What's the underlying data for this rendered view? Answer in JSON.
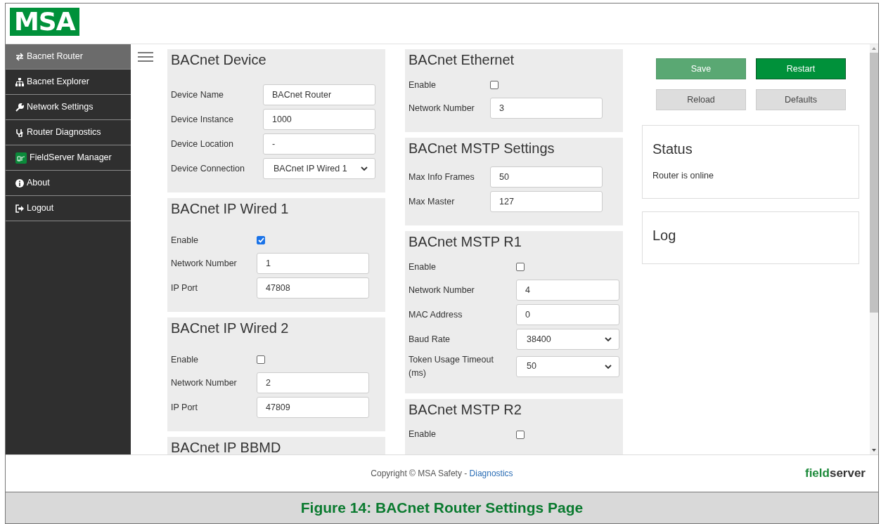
{
  "logo": "MSA",
  "sidebar": {
    "items": [
      {
        "label": "Bacnet Router",
        "selected": true
      },
      {
        "label": "Bacnet Explorer",
        "selected": false
      },
      {
        "label": "Network Settings",
        "selected": false
      },
      {
        "label": "Router Diagnostics",
        "selected": false
      },
      {
        "label": "FieldServer Manager",
        "selected": false
      },
      {
        "label": "About",
        "selected": false
      },
      {
        "label": "Logout",
        "selected": false
      }
    ]
  },
  "columns": [
    [
      {
        "title": "BACnet Device",
        "fields": [
          {
            "label": "Device Name",
            "kind": "text",
            "value": "BACnet Router"
          },
          {
            "label": "Device Instance",
            "kind": "text",
            "value": "1000"
          },
          {
            "label": "Device Location",
            "kind": "text",
            "value": "-"
          },
          {
            "label": "Device Connection",
            "kind": "select",
            "value": "BACnet IP Wired 1"
          }
        ]
      },
      {
        "title": "BACnet IP Wired 1",
        "fields": [
          {
            "label": "Enable",
            "kind": "checkbox",
            "checked": true
          },
          {
            "label": "Network Number",
            "kind": "text",
            "value": "1"
          },
          {
            "label": "IP Port",
            "kind": "text",
            "value": "47808"
          }
        ]
      },
      {
        "title": "BACnet IP Wired 2",
        "fields": [
          {
            "label": "Enable",
            "kind": "checkbox",
            "checked": false
          },
          {
            "label": "Network Number",
            "kind": "text",
            "value": "2"
          },
          {
            "label": "IP Port",
            "kind": "text",
            "value": "47809"
          }
        ]
      },
      {
        "title": "BACnet IP BBMD"
      }
    ],
    [
      {
        "title": "BACnet Ethernet",
        "fields": [
          {
            "label": "Enable",
            "kind": "checkbox",
            "checked": false
          },
          {
            "label": "Network Number",
            "kind": "text",
            "value": "3"
          }
        ]
      },
      {
        "title": "BACnet MSTP Settings",
        "fields": [
          {
            "label": "Max Info Frames",
            "kind": "text",
            "value": "50"
          },
          {
            "label": "Max Master",
            "kind": "text",
            "value": "127"
          }
        ]
      },
      {
        "title": "BACnet MSTP R1",
        "fields": [
          {
            "label": "Enable",
            "kind": "checkbox",
            "checked": false
          },
          {
            "label": "Network Number",
            "kind": "text",
            "value": "4"
          },
          {
            "label": "MAC Address",
            "kind": "text",
            "value": "0"
          },
          {
            "label": "Baud Rate",
            "kind": "select",
            "value": "38400"
          },
          {
            "label": "Token Usage Timeout (ms)",
            "kind": "select",
            "value": "50"
          }
        ]
      },
      {
        "title": "BACnet MSTP R2",
        "fields": [
          {
            "label": "Enable",
            "kind": "checkbox",
            "checked": false
          }
        ]
      }
    ]
  ],
  "actions": [
    {
      "label": "Save",
      "kind": "save"
    },
    {
      "label": "Restart",
      "kind": "restart"
    },
    {
      "label": "Reload",
      "kind": "plain"
    },
    {
      "label": "Defaults",
      "kind": "plain"
    }
  ],
  "status": {
    "title": "Status",
    "text": "Router is online"
  },
  "log": {
    "title": "Log"
  },
  "footer": {
    "copyright": "Copyright © MSA Safety - ",
    "link": "Diagnostics",
    "brand": [
      "field",
      "server"
    ]
  },
  "caption": "Figure 14: BACnet Router Settings Page"
}
